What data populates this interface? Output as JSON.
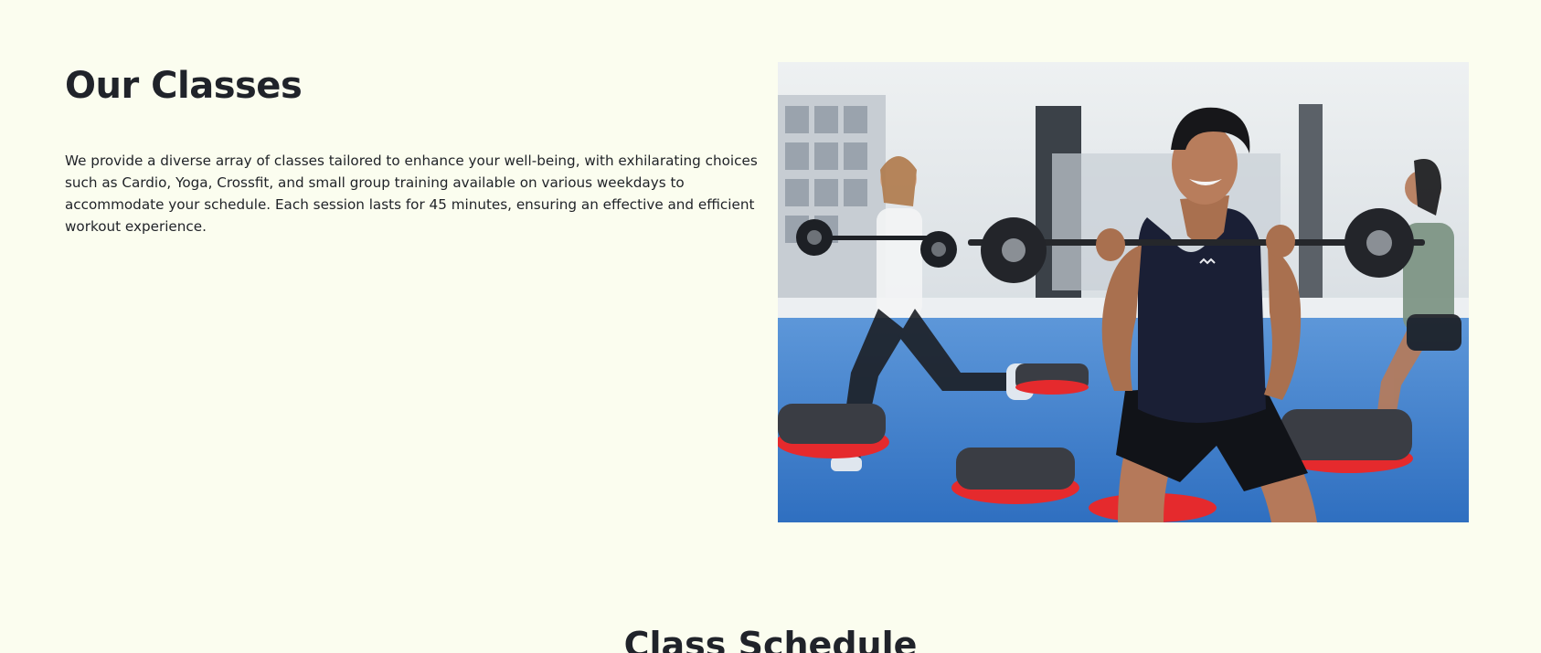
{
  "classes": {
    "title": "Our Classes",
    "description": "We provide a diverse array of classes tailored to enhance your well-being, with exhilarating choices such as Cardio, Yoga, Crossfit, and small group training available on various weekdays to accommodate your schedule. Each session lasts for 45 minutes, ensuring an effective and efficient workout experience.",
    "image_subject": "fitness-class-photo"
  },
  "schedule": {
    "title": "Class Schedule"
  },
  "colors": {
    "page_background": "#fbfdef",
    "heading_text": "#20232a",
    "body_text": "#1f2227",
    "floor_blue": "#3d7fce",
    "step_red": "#e52a2d"
  }
}
